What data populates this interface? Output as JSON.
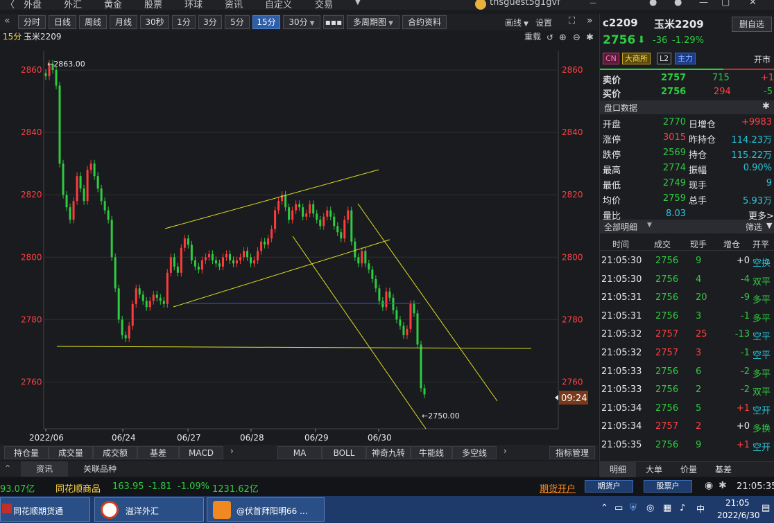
{
  "topnav": {
    "items": [
      "外盘",
      "外汇",
      "黄金",
      "股票",
      "环球",
      "资讯",
      "自定义",
      "交易"
    ],
    "user": "thsguest5g1gvf"
  },
  "toolbar": {
    "periods": [
      "分时",
      "日线",
      "周线",
      "月线",
      "30秒",
      "1分",
      "3分",
      "5分",
      "15分",
      "30分"
    ],
    "active": "15分",
    "more": "▪▪▪",
    "multi": "多周期图",
    "contract": "合约资料",
    "draw": "画线",
    "settings": "设置"
  },
  "chart_header": {
    "period": "15分",
    "name": "玉米2209",
    "reset": "重载"
  },
  "chart_data": {
    "type": "candlestick",
    "ylim": [
      2745,
      2866
    ],
    "yticks": [
      2860,
      2840,
      2820,
      2800,
      2780,
      2760
    ],
    "xticks": [
      "2022/06",
      "06/24",
      "06/27",
      "06/28",
      "06/29",
      "06/30"
    ],
    "annotations": [
      "2863.00",
      "2750.00"
    ],
    "current_time_label": "09:24",
    "closes": [
      2858,
      2862,
      2860,
      2855,
      2830,
      2820,
      2816,
      2812,
      2818,
      2826,
      2822,
      2818,
      2828,
      2830,
      2826,
      2822,
      2818,
      2815,
      2812,
      2800,
      2790,
      2780,
      2775,
      2774,
      2778,
      2785,
      2790,
      2788,
      2786,
      2784,
      2786,
      2788,
      2787,
      2786,
      2785,
      2795,
      2800,
      2797,
      2795,
      2803,
      2806,
      2804,
      2799,
      2797,
      2796,
      2799,
      2800,
      2801,
      2799,
      2798,
      2797,
      2800,
      2801,
      2799,
      2798,
      2799,
      2800,
      2802,
      2800,
      2798,
      2799,
      2802,
      2805,
      2804,
      2806,
      2809,
      2815,
      2818,
      2820,
      2816,
      2812,
      2815,
      2817,
      2816,
      2813,
      2814,
      2817,
      2814,
      2812,
      2810,
      2813,
      2815,
      2813,
      2810,
      2808,
      2806,
      2812,
      2815,
      2805,
      2800,
      2798,
      2802,
      2798,
      2796,
      2793,
      2790,
      2786,
      2784,
      2789,
      2787,
      2783,
      2780,
      2778,
      2775,
      2777,
      2785,
      2782,
      2772,
      2758,
      2756
    ]
  },
  "indicator_tabs": [
    "持仓量",
    "成交量",
    "成交额",
    "基差",
    "MACD"
  ],
  "indicator_tabs2": [
    "MA",
    "BOLL",
    "神奇九转",
    "牛能线",
    "多空线"
  ],
  "indicator_mgr": "指标管理",
  "info_tabs": [
    "资讯",
    "关联品种"
  ],
  "right": {
    "code": "c2209",
    "name": "玉米2209",
    "del": "删自选",
    "price": "2756",
    "change": "-36",
    "pct": "-1.29%",
    "tags": [
      "CN",
      "大商所",
      "L2",
      "主力"
    ],
    "status": "开市",
    "ask_label": "卖价",
    "ask": "2757",
    "ask_vol": "715",
    "ask_chg": "+1",
    "bid_label": "买价",
    "bid": "2756",
    "bid_vol": "294",
    "bid_chg": "-5",
    "pankou_title": "盘口数据",
    "stats": [
      [
        "开盘",
        "2770",
        "日增仓",
        "+9983"
      ],
      [
        "涨停",
        "3015",
        "昨持仓",
        "114.23万"
      ],
      [
        "跌停",
        "2569",
        "持仓",
        "115.22万"
      ],
      [
        "最高",
        "2774",
        "振幅",
        "0.90%"
      ],
      [
        "最低",
        "2749",
        "现手",
        "9"
      ],
      [
        "均价",
        "2759",
        "总手",
        "5.93万"
      ],
      [
        "量比",
        "8.03",
        "更多>",
        ""
      ]
    ],
    "detail_title": "全部明细",
    "filter": "筛选",
    "detail_headers": [
      "时间",
      "成交",
      "现手",
      "增仓",
      "开平"
    ],
    "ticks": [
      [
        "21:05:30",
        "2756",
        "9",
        "+0",
        "空换"
      ],
      [
        "21:05:30",
        "2756",
        "4",
        "-4",
        "双平"
      ],
      [
        "21:05:31",
        "2756",
        "20",
        "-9",
        "多平"
      ],
      [
        "21:05:31",
        "2756",
        "3",
        "-1",
        "多平"
      ],
      [
        "21:05:32",
        "2757",
        "25",
        "-13",
        "空平"
      ],
      [
        "21:05:32",
        "2757",
        "3",
        "-1",
        "空平"
      ],
      [
        "21:05:33",
        "2756",
        "6",
        "-2",
        "多平"
      ],
      [
        "21:05:33",
        "2756",
        "2",
        "-2",
        "双平"
      ],
      [
        "21:05:34",
        "2756",
        "5",
        "+1",
        "空开"
      ],
      [
        "21:05:34",
        "2757",
        "2",
        "+0",
        "多换"
      ],
      [
        "21:05:35",
        "2756",
        "9",
        "+1",
        "空开"
      ]
    ],
    "bottom_tabs": [
      "明细",
      "大单",
      "价量",
      "基差"
    ]
  },
  "ticker": {
    "left_value": "93.07亿",
    "name": "同花顺商品",
    "v1": "163.95",
    "v2": "-1.81",
    "v3": "-1.09%",
    "v4": "1231.62亿",
    "futures_open": "期货开户",
    "btn1": "期货户",
    "btn2": "股票户",
    "time": "21:05:35"
  },
  "taskbar": {
    "apps": [
      "同花顺期货通",
      "溢洋外汇",
      "@伏首拜阳明66 ..."
    ],
    "clock": "21:05",
    "date": "2022/6/30"
  }
}
